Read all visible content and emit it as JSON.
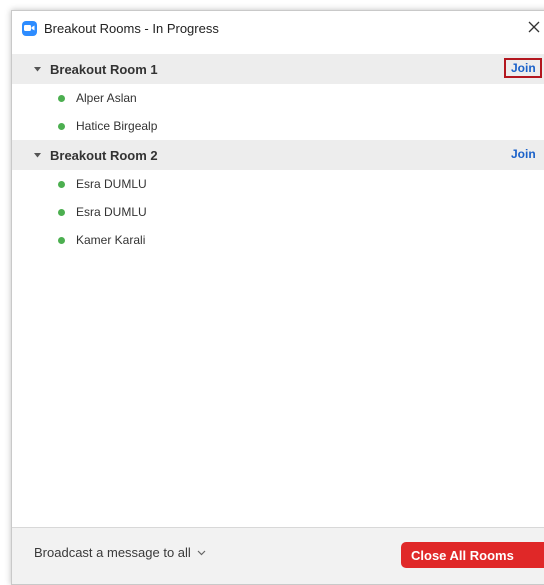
{
  "window": {
    "title": "Breakout Rooms - In Progress",
    "app_icon": "zoom-camera-icon",
    "close_icon": "close-icon"
  },
  "rooms": [
    {
      "name": "Breakout Room 1",
      "join_label": "Join",
      "join_highlighted": true,
      "participants": [
        "Alper Aslan",
        "Hatice Birgealp"
      ]
    },
    {
      "name": "Breakout Room 2",
      "join_label": "Join",
      "join_highlighted": false,
      "participants": [
        "Esra DUMLU",
        "Esra DUMLU",
        "Kamer Karali"
      ]
    }
  ],
  "footer": {
    "broadcast_label": "Broadcast a message to all",
    "close_all_label": "Close All Rooms"
  },
  "colors": {
    "accent": "#2d8cff",
    "join_link": "#1a61c9",
    "highlight_border": "#b3171f",
    "close_all_bg": "#e02828",
    "status_dot": "#4caf50",
    "room_header_bg": "#ededed"
  }
}
